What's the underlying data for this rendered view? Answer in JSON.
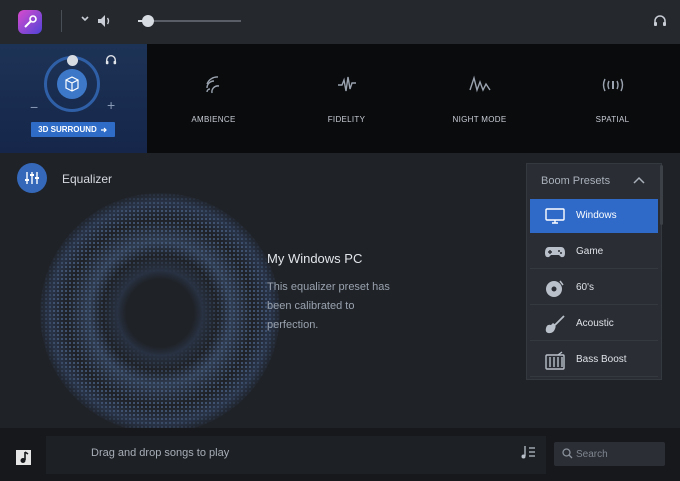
{
  "topbar": {
    "volume_percent": 10
  },
  "surround": {
    "button_label": "3D SURROUND",
    "minus": "−",
    "plus": "+"
  },
  "effects": [
    {
      "label": "AMBIENCE",
      "icon": "ambience-icon"
    },
    {
      "label": "FIDELITY",
      "icon": "fidelity-icon"
    },
    {
      "label": "NIGHT MODE",
      "icon": "night-mode-icon"
    },
    {
      "label": "SPATIAL",
      "icon": "spatial-icon"
    }
  ],
  "equalizer": {
    "title": "Equalizer",
    "preset_name": "My Windows PC",
    "preset_desc": "This equalizer preset has been calibrated to perfection."
  },
  "presets": {
    "header": "Boom Presets",
    "items": [
      {
        "label": "Windows",
        "icon": "monitor-icon",
        "active": true
      },
      {
        "label": "Game",
        "icon": "gamepad-icon",
        "active": false
      },
      {
        "label": "60's",
        "icon": "vinyl-icon",
        "active": false
      },
      {
        "label": "Acoustic",
        "icon": "guitar-icon",
        "active": false
      },
      {
        "label": "Bass Boost",
        "icon": "bass-boost-icon",
        "active": false
      }
    ]
  },
  "bottom": {
    "drop_text": "Drag and drop songs to play",
    "search_placeholder": "Search"
  },
  "colors": {
    "accent": "#2f6ac8",
    "background": "#1f2227"
  }
}
